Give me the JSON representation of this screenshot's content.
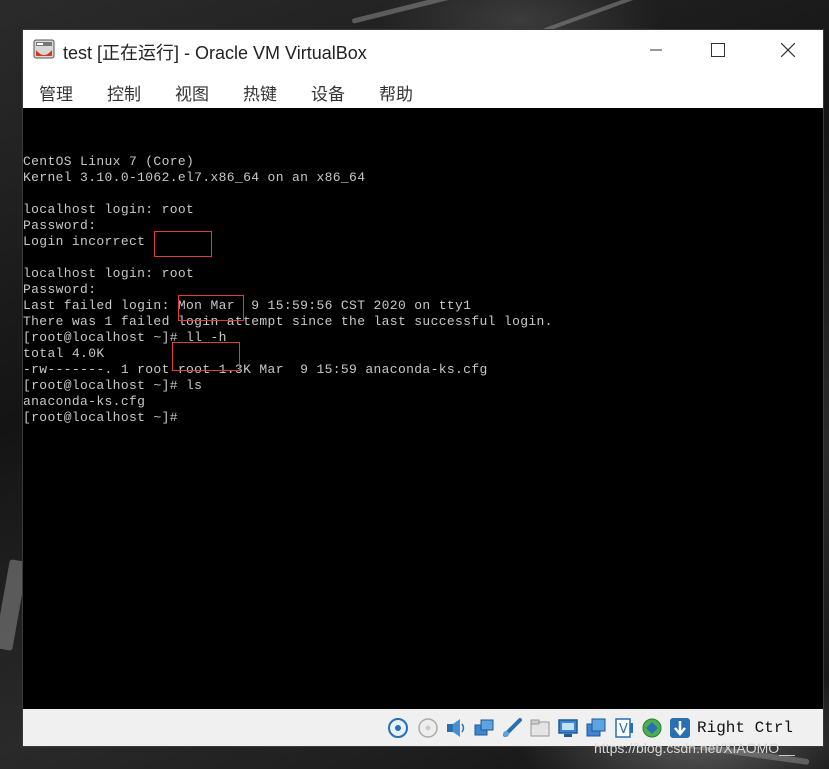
{
  "window": {
    "title": "test [正在运行] - Oracle VM VirtualBox"
  },
  "menu": {
    "items": [
      "管理",
      "控制",
      "视图",
      "热键",
      "设备",
      "帮助"
    ]
  },
  "console": {
    "lines": [
      "CentOS Linux 7 (Core)",
      "Kernel 3.10.0-1062.el7.x86_64 on an x86_64",
      "",
      "localhost login: root",
      "Password:",
      "Login incorrect",
      "",
      "localhost login: root",
      "Password:",
      "Last failed login: Mon Mar  9 15:59:56 CST 2020 on tty1",
      "There was 1 failed login attempt since the last successful login.",
      "[root@localhost ~]# ll -h",
      "total 4.0K",
      "-rw-------. 1 root root 1.3K Mar  9 15:59 anaconda-ks.cfg",
      "[root@localhost ~]# ls",
      "anaconda-ks.cfg",
      "[root@localhost ~]#"
    ]
  },
  "statusbar": {
    "icons": [
      "hard-disk-icon",
      "optical-drive-icon",
      "audio-icon",
      "network-icon",
      "usb-icon",
      "shared-folders-icon",
      "display-icon",
      "screen-capture-icon",
      "virtualization-icon",
      "mouse-integration-icon",
      "keyboard-capture-icon"
    ],
    "host_key": "Right Ctrl"
  },
  "watermark": "https://blog.csdn.net/XIAOMO__"
}
